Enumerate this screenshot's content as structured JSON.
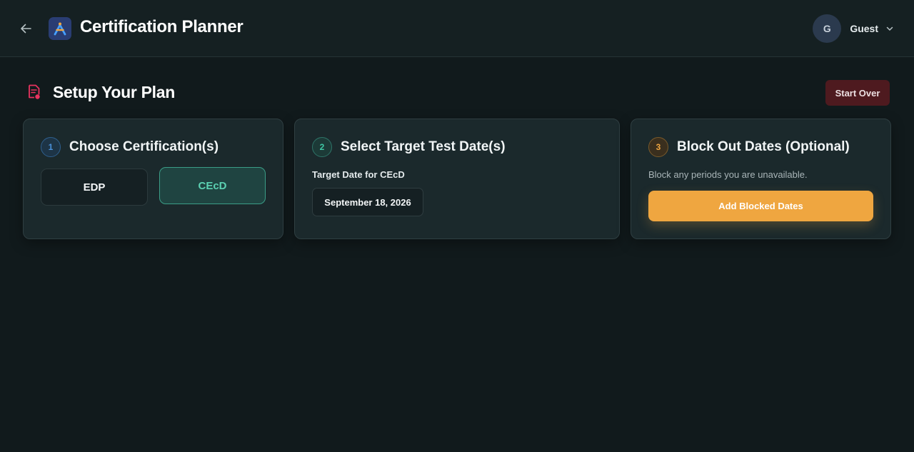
{
  "header": {
    "app_title": "Certification Planner",
    "back_icon": "arrow-left-icon",
    "logo_icon": "app-logo-icon",
    "user": {
      "initial": "G",
      "name": "Guest",
      "menu_icon": "chevron-down-icon"
    }
  },
  "page": {
    "section_title": "Setup Your Plan",
    "section_icon": "plan-document-icon",
    "start_over_label": "Start Over"
  },
  "steps": [
    {
      "number": "1",
      "title": "Choose Certification(s)",
      "options": [
        {
          "label": "EDP",
          "selected": false
        },
        {
          "label": "CEcD",
          "selected": true
        }
      ]
    },
    {
      "number": "2",
      "title": "Select Target Test Date(s)",
      "field_label": "Target Date for CEcD",
      "date_value": "September 18, 2026"
    },
    {
      "number": "3",
      "title": "Block Out Dates (Optional)",
      "description": "Block any periods you are unavailable.",
      "button_label": "Add Blocked Dates"
    }
  ],
  "colors": {
    "accent_blue": "#4a90d9",
    "accent_teal": "#3fc9a5",
    "accent_orange": "#efa640",
    "danger_bg": "#4e1a1f",
    "icon_pink": "#e8335f"
  }
}
